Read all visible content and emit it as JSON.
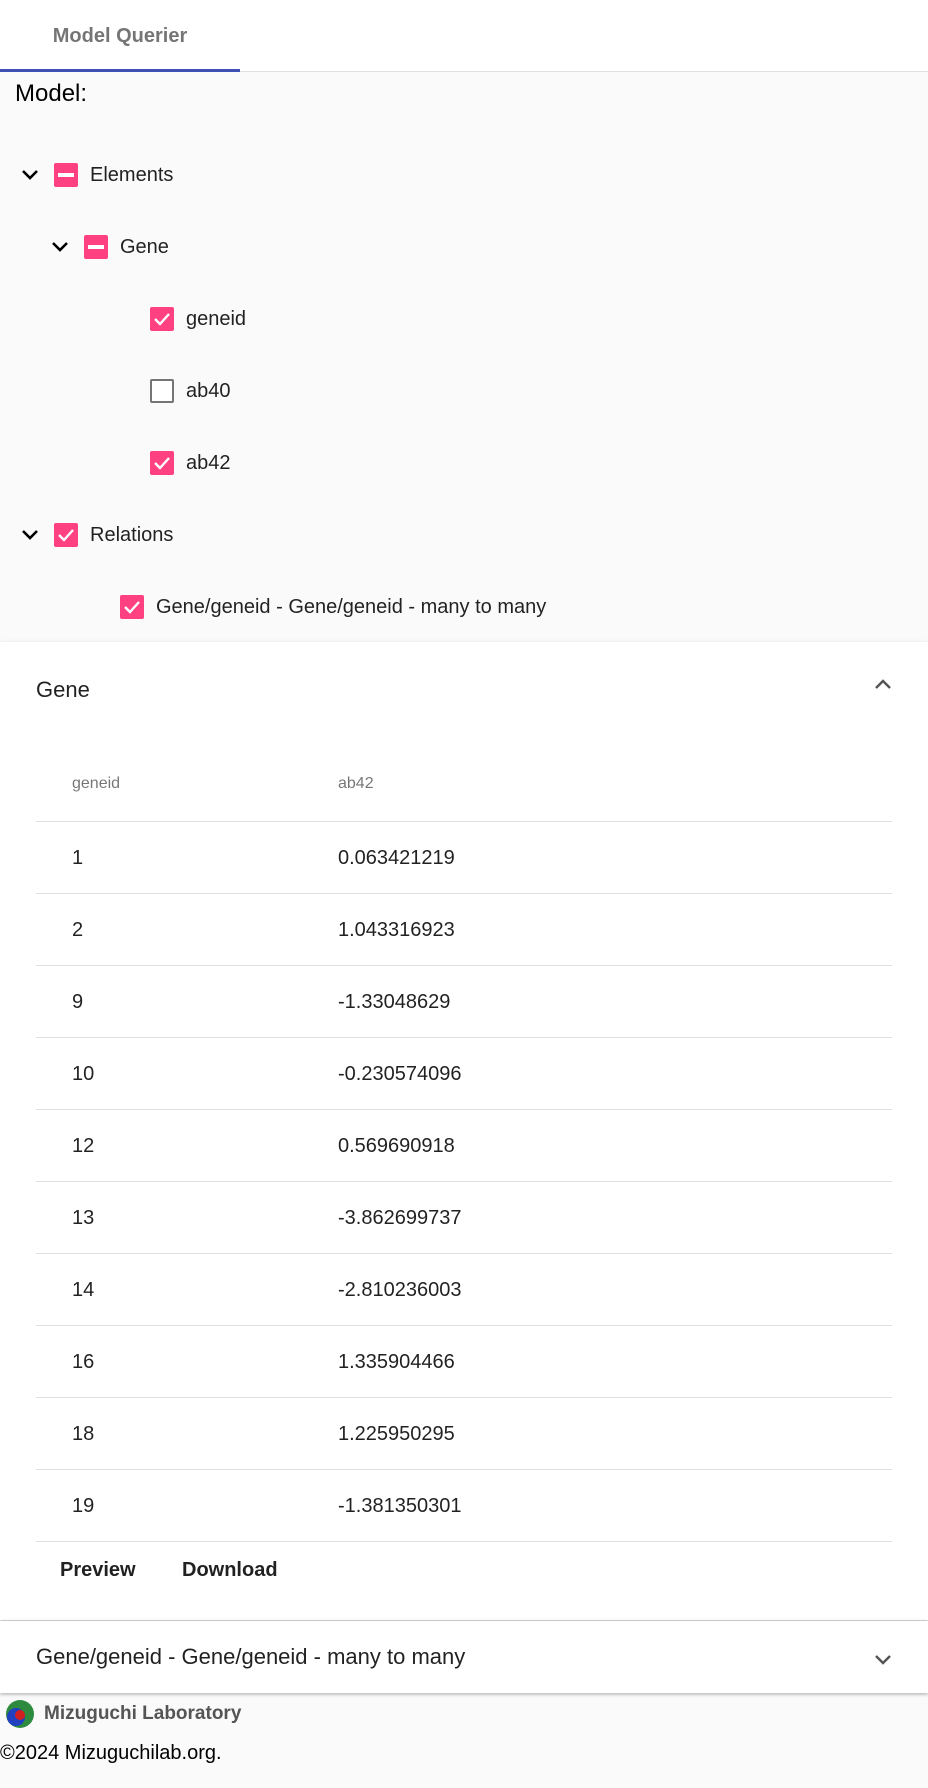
{
  "tabs": [
    {
      "label": "Model Querier"
    }
  ],
  "model_label": "Model:",
  "tree": {
    "elements_label": "Elements",
    "gene_label": "Gene",
    "fields": [
      {
        "label": "geneid",
        "checked": true
      },
      {
        "label": "ab40",
        "checked": false
      },
      {
        "label": "ab42",
        "checked": true
      }
    ],
    "relations_label": "Relations",
    "relation_item": "Gene/geneid - Gene/geneid - many to many"
  },
  "panel": {
    "title": "Gene",
    "columns": [
      "geneid",
      "ab42"
    ],
    "rows": [
      [
        "1",
        "0.063421219"
      ],
      [
        "2",
        "1.043316923"
      ],
      [
        "9",
        "-1.33048629"
      ],
      [
        "10",
        "-0.230574096"
      ],
      [
        "12",
        "0.569690918"
      ],
      [
        "13",
        "-3.862699737"
      ],
      [
        "14",
        "-2.810236003"
      ],
      [
        "16",
        "1.335904466"
      ],
      [
        "18",
        "1.225950295"
      ],
      [
        "19",
        "-1.381350301"
      ]
    ],
    "preview_label": "Preview",
    "download_label": "Download"
  },
  "panel2": {
    "title": "Gene/geneid - Gene/geneid - many to many"
  },
  "footer": {
    "logo_text": "Mizuguchi Laboratory",
    "copyright": "©2024 Mizuguchilab.org."
  },
  "colors": {
    "accent": "#ff4081",
    "primary": "#3f51b5"
  }
}
